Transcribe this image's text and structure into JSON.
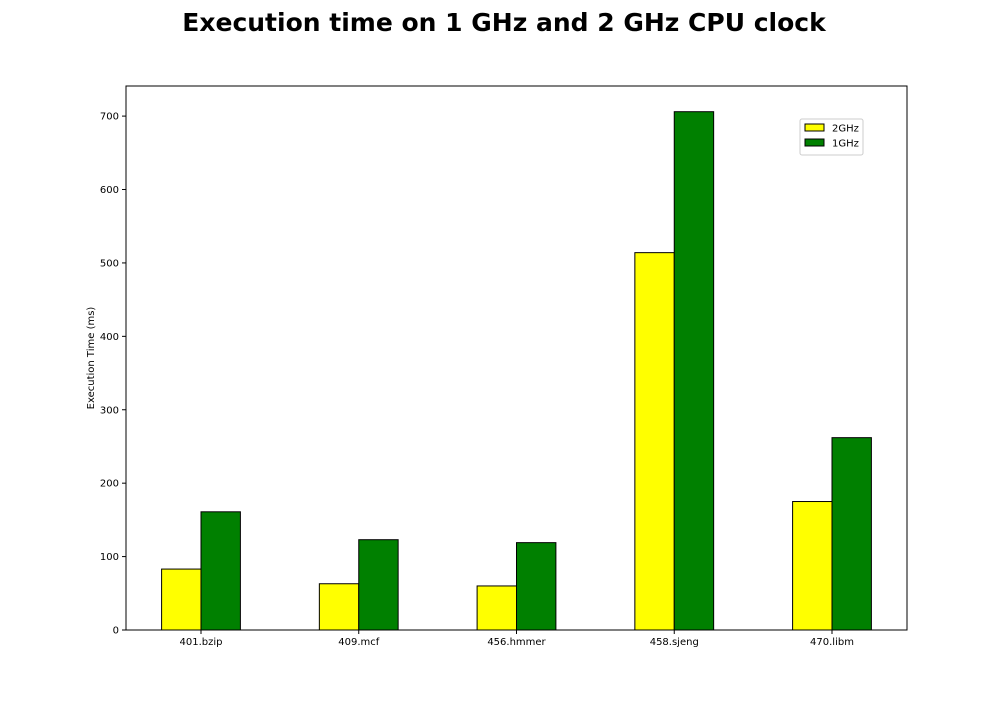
{
  "chart_data": {
    "type": "bar",
    "title": "Execution time on 1 GHz and 2 GHz CPU clock",
    "xlabel": "",
    "ylabel": "Execution Time (ms)",
    "categories": [
      "401.bzip",
      "409.mcf",
      "456.hmmer",
      "458.sjeng",
      "470.libm"
    ],
    "series": [
      {
        "name": "2GHz",
        "color": "#ffff00",
        "values": [
          83,
          63,
          60,
          514,
          175
        ]
      },
      {
        "name": "1GHz",
        "color": "#008000",
        "values": [
          161,
          123,
          119,
          706,
          262
        ]
      }
    ],
    "ylim": [
      0,
      741
    ],
    "yticks": [
      0,
      100,
      200,
      300,
      400,
      500,
      600,
      700
    ],
    "legend_position": "top-right",
    "grid": false
  }
}
